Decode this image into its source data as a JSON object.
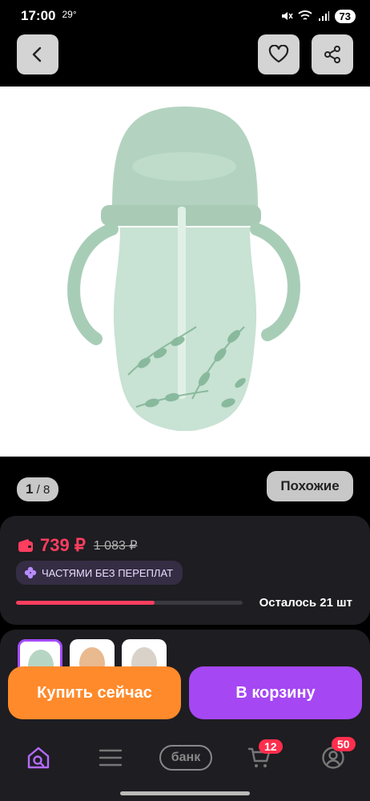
{
  "status": {
    "time": "17:00",
    "temperature": "29°",
    "battery": "73",
    "icons": [
      "mute-icon",
      "wifi-icon",
      "signal-icon"
    ]
  },
  "header": {
    "back_icon": "chevron-left-icon",
    "favorite_icon": "heart-icon",
    "share_icon": "share-icon"
  },
  "gallery": {
    "current": "1",
    "total": "8",
    "similar_label": "Похожие"
  },
  "price": {
    "current": "739 ₽",
    "old": "1 083 ₽",
    "wallet_icon": "wallet-icon",
    "installment_label": "ЧАСТЯМИ БЕЗ ПЕРЕПЛАТ",
    "installment_icon": "clover-icon"
  },
  "stock": {
    "label": "Осталось 21 шт",
    "fill_fraction": 0.61
  },
  "variants": [
    {
      "color": "#b7d5c3",
      "selected": true
    },
    {
      "color": "#e9b98f",
      "selected": false
    },
    {
      "color": "#d9d2c9",
      "selected": false
    }
  ],
  "actions": {
    "buy_now": "Купить сейчас",
    "add_to_cart": "В корзину"
  },
  "bottom_nav": {
    "home_icon": "home-search-icon",
    "catalog_icon": "menu-icon",
    "bank_label": "банк",
    "cart_icon": "cart-icon",
    "cart_badge": "12",
    "profile_icon": "profile-icon",
    "profile_badge": "50"
  },
  "colors": {
    "accent_purple": "#a547f3",
    "accent_orange": "#ff8a2b",
    "price_red": "#ff3e5f",
    "product_green": "#a8cdb7"
  }
}
